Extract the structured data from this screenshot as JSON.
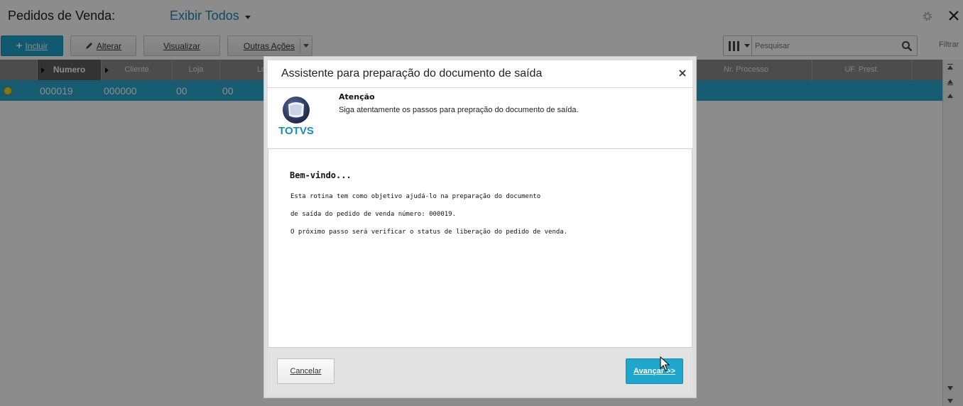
{
  "header": {
    "title": "Pedidos de Venda:",
    "view_label": "Exibir Todos"
  },
  "toolbar": {
    "incluir_label": "Incluir",
    "alterar_label": "Alterar",
    "visualizar_label": "Visualizar",
    "outras_label": "Outras Ações",
    "search_placeholder": "Pesquisar",
    "filtrar_label": "Filtrar"
  },
  "grid": {
    "columns": [
      "Numero",
      "Cliente",
      "Loja",
      "Lo",
      "Nr. Processo",
      "UF. Prest."
    ],
    "rows": [
      {
        "status_color": "#e8df2c",
        "cells": [
          "000019",
          "000000",
          "00",
          "00"
        ]
      }
    ]
  },
  "modal": {
    "title": "Assistente para preparação do documento de saída",
    "logo_text": "TOTVS",
    "banner_title": "Atenção",
    "banner_subtitle": "Siga atentamente os passos para prepração do documento de saída.",
    "welcome": "Bem-vindo...",
    "paragraphs": [
      "Esta rotina tem como objetivo ajudá-lo na preparação do documento",
      "de saída do pedido de venda número: 000019.",
      "O próximo passo será verificar o status de liberação do pedido de venda."
    ],
    "cancel_label": "Cancelar",
    "next_label": "Avançar >>"
  },
  "colors": {
    "accent": "#1ea6cc",
    "selected_row": "#2aa6cc",
    "link": "#1a8db5"
  }
}
